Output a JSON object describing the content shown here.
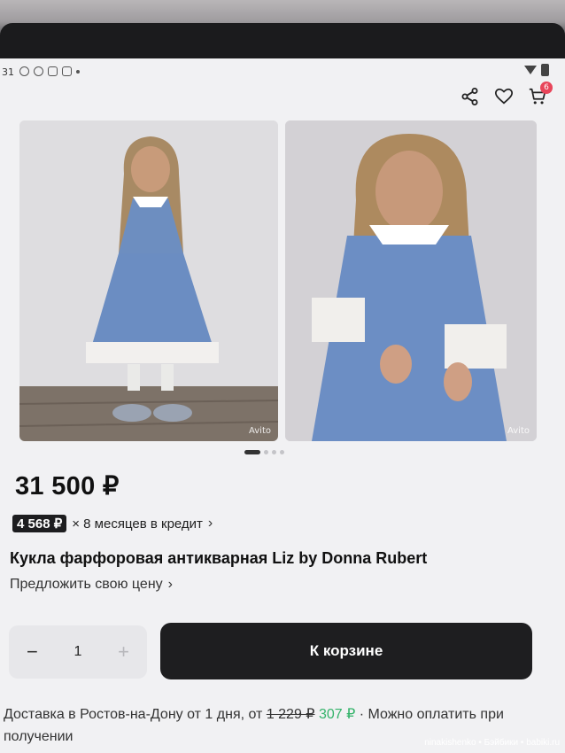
{
  "status_bar": {
    "time": "31",
    "icons": [
      "sync-icon",
      "location-icon",
      "message-icon",
      "mail-icon",
      "dot-icon"
    ],
    "right_icons": [
      "wifi-icon",
      "battery-icon"
    ]
  },
  "app_bar": {
    "icons": [
      "share-icon",
      "heart-icon",
      "cart-icon"
    ],
    "cart_badge": "6"
  },
  "gallery": {
    "watermarks": [
      "Avito",
      "Avito"
    ],
    "page_indicator_count": 4,
    "active_index": 0
  },
  "product": {
    "price": "31 500 ₽",
    "credit_amount": "4 568 ₽",
    "credit_text": "× 8 месяцев в кредит",
    "title": "Кукла фарфоровая антикварная Liz by Donna Rubert",
    "offer_link": "Предложить свою цену"
  },
  "quantity": {
    "minus": "−",
    "value": "1",
    "plus": "+"
  },
  "cart_button": "К корзине",
  "delivery": {
    "prefix": "Доставка в Ростов-на-Дону от 1 дня, от ",
    "old_price": "1 229 ₽",
    "new_price": "307 ₽",
    "suffix": " · Можно оплатить при получении"
  },
  "photo_credit": "ninakishenko • Бэйбики • babiki.ru",
  "colors": {
    "badge": "#e8455a",
    "green_price": "#34b36a",
    "button_bg": "#1e1e20"
  }
}
